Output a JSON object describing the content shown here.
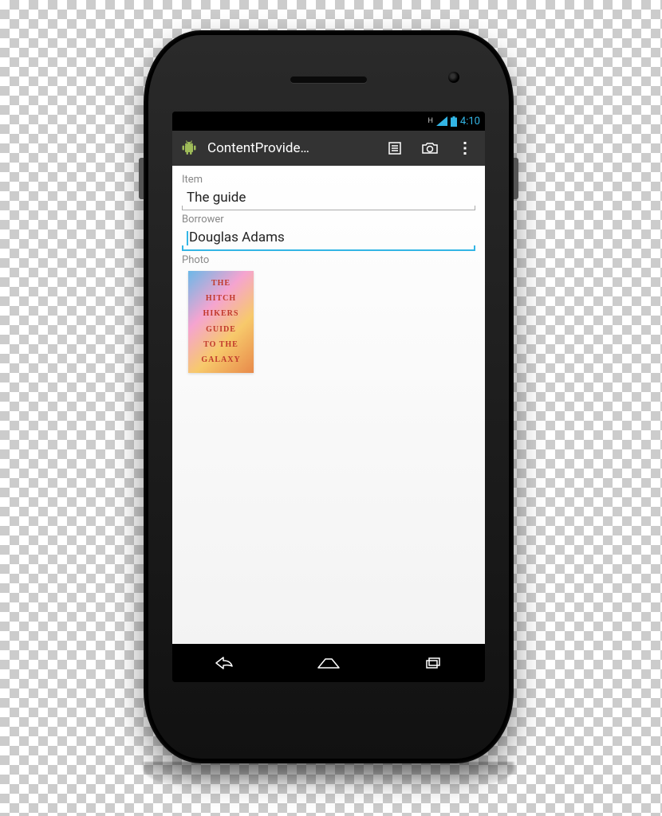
{
  "statusbar": {
    "network_label": "H",
    "time": "4:10"
  },
  "actionbar": {
    "title": "ContentProvide…"
  },
  "form": {
    "item": {
      "label": "Item",
      "value": "The guide"
    },
    "borrower": {
      "label": "Borrower",
      "value": "Douglas Adams"
    },
    "photo": {
      "label": "Photo",
      "cover_lines": [
        "THE",
        "HITCH",
        "HIKERS",
        "GUIDE",
        "TO THE",
        "GALAXY"
      ]
    }
  }
}
